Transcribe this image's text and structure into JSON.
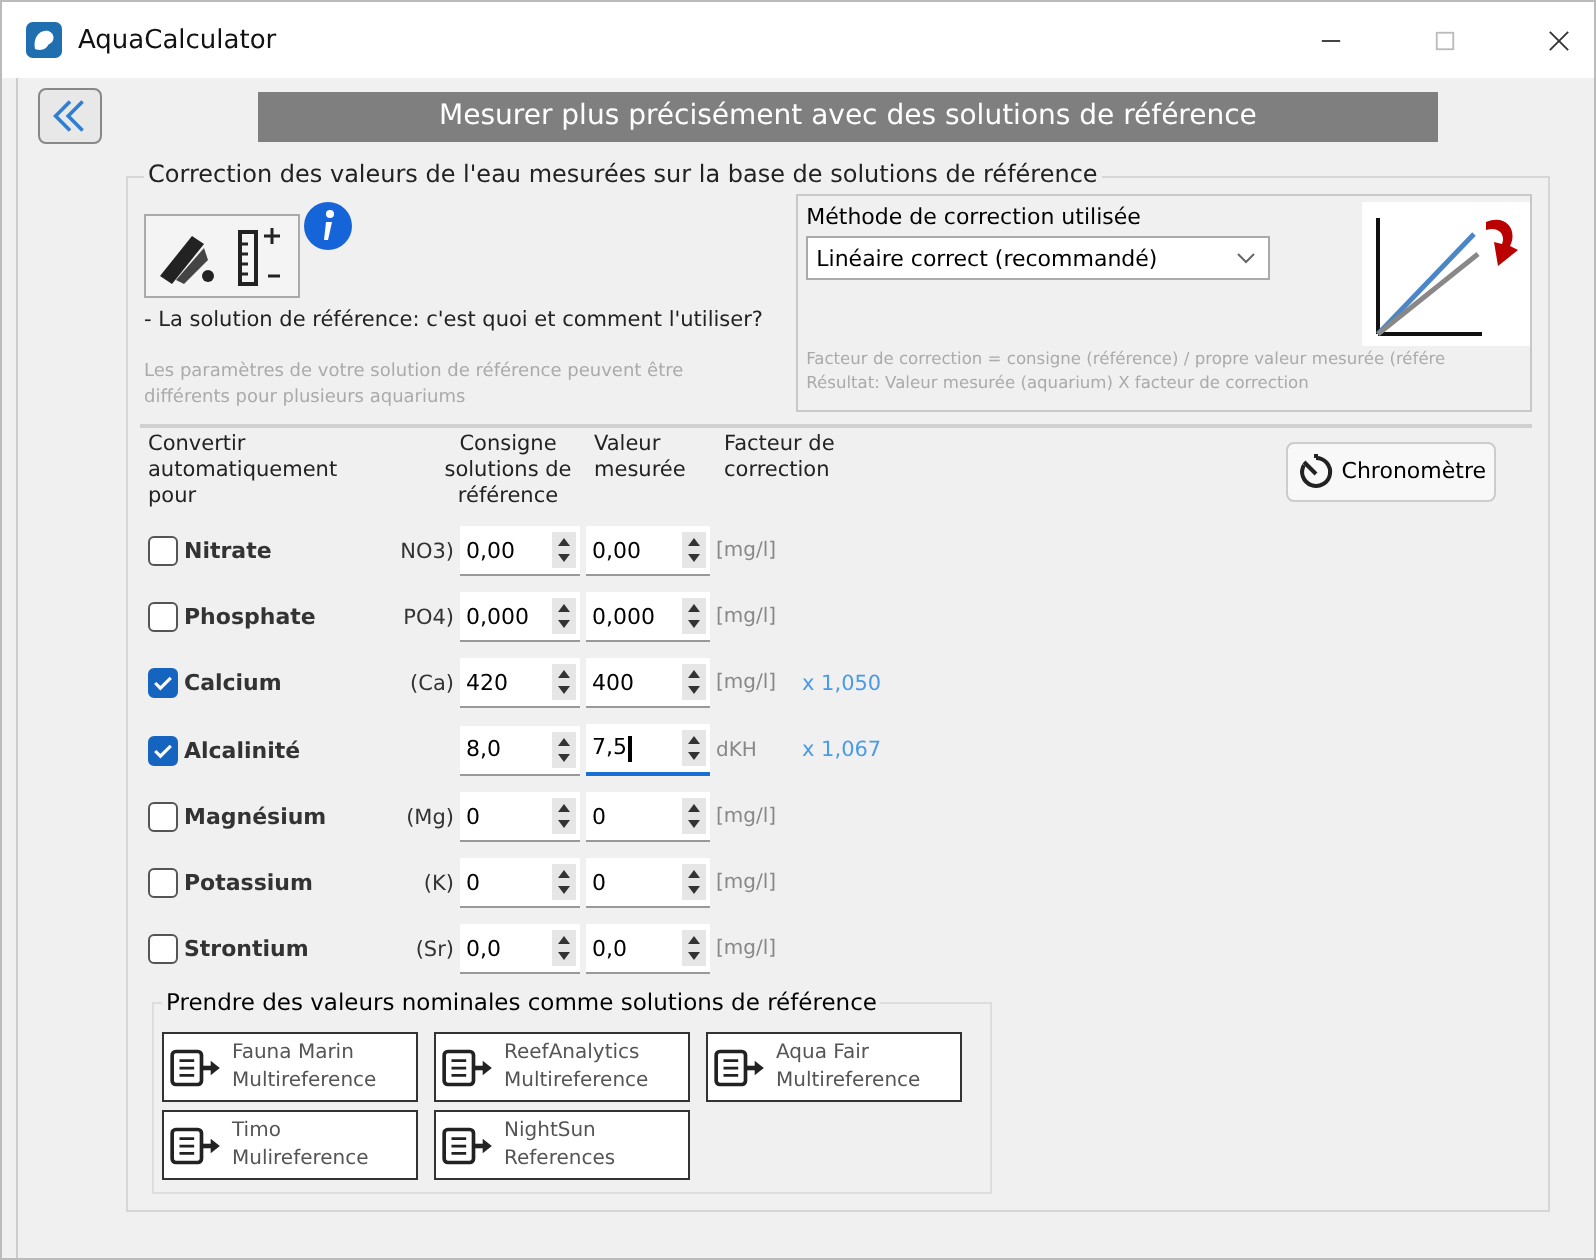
{
  "window": {
    "title": "AquaCalculator"
  },
  "header": "Mesurer plus précisément avec des solutions de référence",
  "group": {
    "title": "Correction des valeurs de l'eau mesurées sur la base de solutions de référence",
    "help_link": "- La solution de référence: c'est quoi et comment l'utiliser?",
    "note": "Les paramètres de votre solution de référence peuvent être différents pour plusieurs aquariums",
    "method": {
      "label": "Méthode de correction utilisée",
      "value": "Linéaire correct (recommandé)",
      "formula": "Facteur de correction = consigne (référence) / propre valeur mesurée (référe",
      "result": "Résultat: Valeur mesurée (aquarium) X facteur de correction"
    },
    "columns": [
      "Convertir automatiquement pour",
      "Consigne solutions de référence",
      "Valeur mesurée",
      "Facteur de correction"
    ],
    "stopwatch": "Chronomètre",
    "rows": [
      {
        "name": "Nitrate",
        "formula": "NO3)",
        "reference": "0,00",
        "measured": "0,00",
        "focused": false,
        "unit": "[mg/l]",
        "checked": false
      },
      {
        "name": "Phosphate",
        "formula": "PO4)",
        "reference": "0,000",
        "measured": "0,000",
        "focused": false,
        "unit": "[mg/l]",
        "checked": false
      },
      {
        "name": "Calcium",
        "formula": "(Ca)",
        "reference": "420",
        "measured": "400",
        "focused": false,
        "unit": "[mg/l]",
        "factor": "x 1,050",
        "checked": true
      },
      {
        "name": "Alcalinité",
        "reference": "8,0",
        "measured": "7,5",
        "focused": true,
        "unit": "dKH",
        "factor": "x 1,067",
        "checked": true
      },
      {
        "name": "Magnésium",
        "formula": "(Mg)",
        "reference": "0",
        "measured": "0",
        "focused": false,
        "unit": "[mg/l]",
        "checked": false
      },
      {
        "name": "Potassium",
        "formula": "(K)",
        "reference": "0",
        "measured": "0",
        "focused": false,
        "unit": "[mg/l]",
        "checked": false
      },
      {
        "name": "Strontium",
        "formula": "(Sr)",
        "reference": "0,0",
        "measured": "0,0",
        "focused": false,
        "unit": "[mg/l]",
        "checked": false
      }
    ],
    "presets": {
      "title": "Prendre des valeurs nominales comme solutions de référence",
      "buttons": [
        {
          "line1": "Fauna Marin",
          "line2": "Multireference"
        },
        {
          "line1": "ReefAnalytics",
          "line2": "Multireference"
        },
        {
          "line1": "Aqua Fair",
          "line2": "Multireference"
        },
        {
          "line1": "Timo",
          "line2": "Mulireference"
        },
        {
          "line1": "NightSun",
          "line2": "References"
        }
      ]
    }
  }
}
